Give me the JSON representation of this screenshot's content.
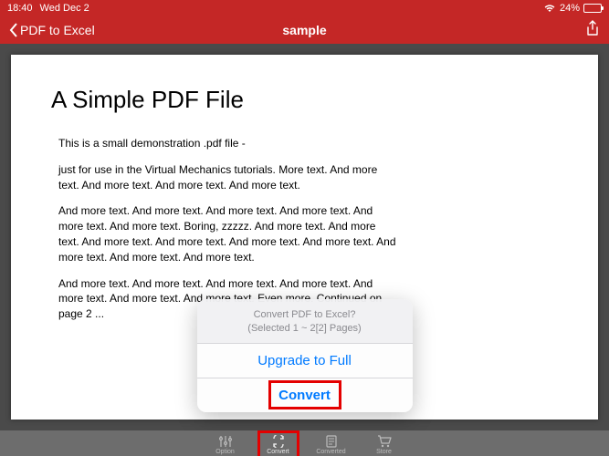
{
  "status": {
    "time": "18:40",
    "date": "Wed Dec 2",
    "battery_pct": "24%"
  },
  "nav": {
    "back_label": "PDF to Excel",
    "title": "sample"
  },
  "document": {
    "title": "A Simple PDF File",
    "paragraphs": [
      "This is a small demonstration .pdf file -",
      "just for use in the Virtual Mechanics tutorials. More text. And more text. And more text. And more text. And more text.",
      "And more text. And more text. And more text. And more text. And more text. And more text. Boring, zzzzz. And more text. And more text. And more text. And more text. And more text. And more text. And more text. And more text. And more text.",
      "And more text. And more text. And more text. And more text. And more text. And more text. And more text. Even more. Continued on page 2 ..."
    ]
  },
  "popup": {
    "line1": "Convert PDF to Excel?",
    "line2": "(Selected 1 ~ 2[2] Pages)",
    "upgrade_label": "Upgrade to Full",
    "convert_label": "Convert"
  },
  "tabs": {
    "option": "Option",
    "convert": "Convert",
    "converted": "Converted",
    "store": "Store"
  }
}
